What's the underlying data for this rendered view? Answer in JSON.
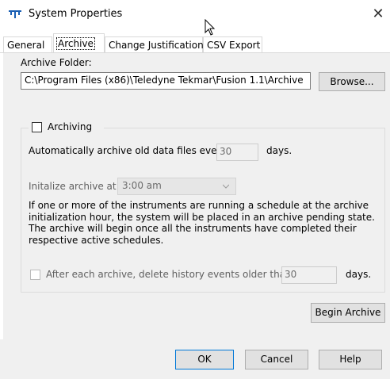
{
  "window": {
    "title": "System Properties",
    "close_glyph": "✕",
    "icon": "teledyne-logo-icon"
  },
  "tabs": [
    {
      "label": "General"
    },
    {
      "label": "Archive",
      "active": true
    },
    {
      "label": "Change Justification"
    },
    {
      "label": "CSV Export"
    }
  ],
  "archive_folder": {
    "label": "Archive Folder:",
    "path": "C:\\Program Files (x86)\\Teledyne Tekmar\\Fusion 1.1\\Archive",
    "browse_label": "Browse..."
  },
  "archiving": {
    "checkbox_label": "Archiving",
    "checked": false,
    "auto_label": "Automatically archive old data files every",
    "auto_value": "30",
    "auto_unit": "days.",
    "init_label": "Initalize archive at",
    "init_time": "3:00 am",
    "info_lines": [
      "If one or more of the instruments are running a schedule at the archive",
      "initialization hour, the system will be placed in an archive pending state.",
      "The archive will begin once all the instruments have completed their",
      "respective active schedules."
    ],
    "history_label": "After each archive, delete history events older than",
    "history_checked": false,
    "history_value": "30",
    "history_unit": "days."
  },
  "begin_archive_label": "Begin Archive",
  "footer": {
    "ok_label": "OK",
    "cancel_label": "Cancel",
    "help_label": "Help"
  },
  "colors": {
    "accent": "#0078d7",
    "panel": "#f0f0f0",
    "logo": "#1a5fb4"
  }
}
